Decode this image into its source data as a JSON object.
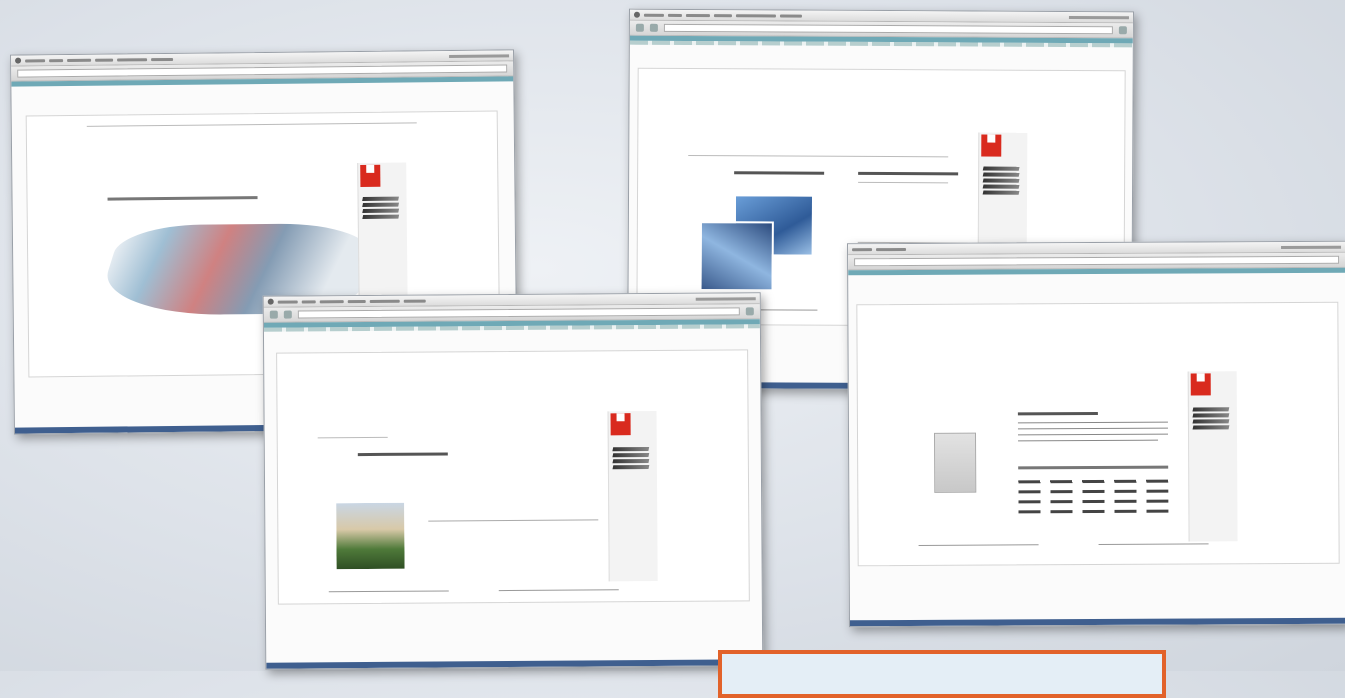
{
  "screenshots": [
    {
      "name": "window-top-left"
    },
    {
      "name": "window-bottom-middle"
    },
    {
      "name": "window-top-right"
    },
    {
      "name": "window-far-right"
    }
  ],
  "colors": {
    "background": "#dde2e9",
    "window_border": "#9aa0a8",
    "tab_strip": "#6fa9b6",
    "status_bar": "#3f5f8f",
    "logo_red": "#d92a1e",
    "callout_border": "#e2622a"
  }
}
